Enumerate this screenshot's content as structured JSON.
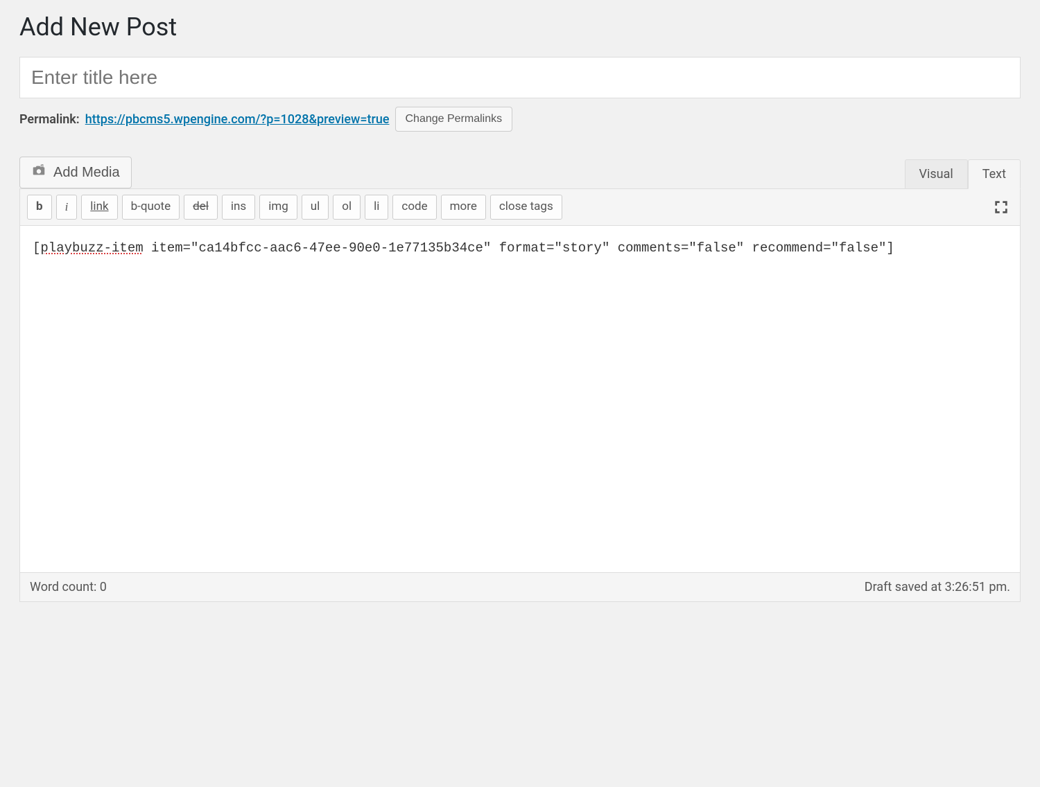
{
  "page": {
    "title": "Add New Post"
  },
  "title_input": {
    "value": "",
    "placeholder": "Enter title here"
  },
  "permalink": {
    "label": "Permalink:",
    "url": "https://pbcms5.wpengine.com/?p=1028&preview=true",
    "change_button": "Change Permalinks"
  },
  "media": {
    "add_media_label": "Add Media"
  },
  "tabs": {
    "visual": "Visual",
    "text": "Text",
    "active": "text"
  },
  "quicktags": {
    "b": "b",
    "i": "i",
    "link": "link",
    "bquote": "b-quote",
    "del": "del",
    "ins": "ins",
    "img": "img",
    "ul": "ul",
    "ol": "ol",
    "li": "li",
    "code": "code",
    "more": "more",
    "close": "close tags"
  },
  "editor": {
    "spellcheck_prefix": "[",
    "spellcheck_word": "playbuzz-item",
    "content_rest": " item=\"ca14bfcc-aac6-47ee-90e0-1e77135b34ce\" format=\"story\" comments=\"false\" recommend=\"false\"]"
  },
  "status": {
    "wordcount_label": "Word count: ",
    "wordcount_value": "0",
    "draft_saved": "Draft saved at 3:26:51 pm."
  }
}
